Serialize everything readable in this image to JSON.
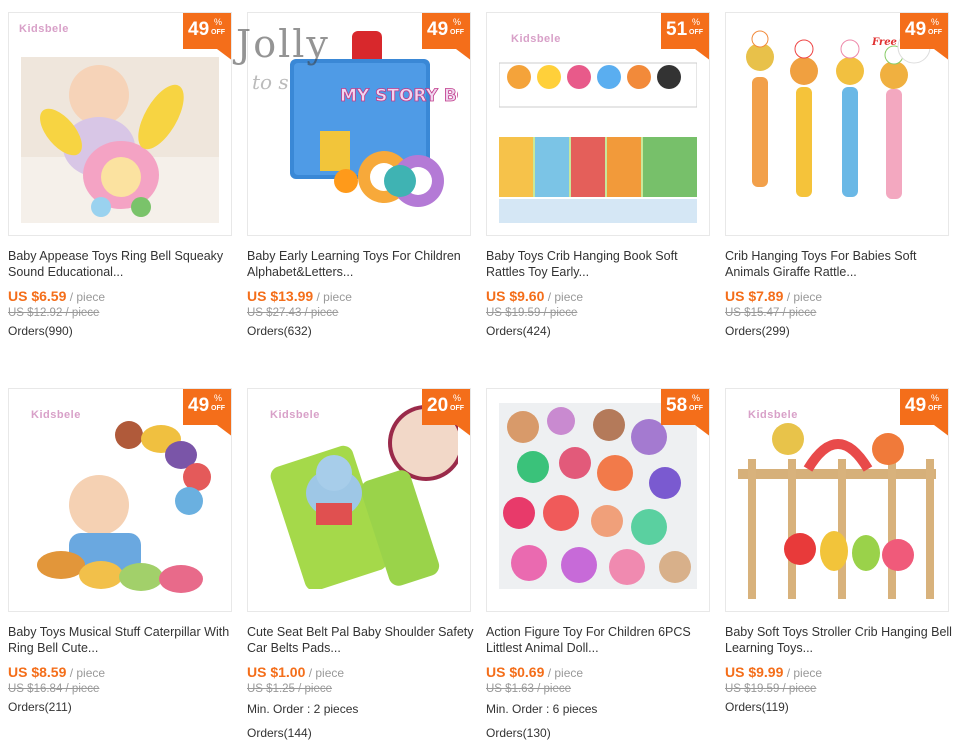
{
  "watermark": {
    "main": "Jolly",
    "sub": "to s"
  },
  "colors": {
    "accent": "#f46e1a",
    "badge": "#f46e1a",
    "muted": "#999999",
    "text": "#333333",
    "brand": "#d8a0c8"
  },
  "products": [
    {
      "brand": "Kidsbele",
      "discount": "49",
      "pct": "%",
      "off": "OFF",
      "title": "Baby Appease Toys Ring Bell Squeaky Sound Educational...",
      "price": "US $6.59",
      "unit": "/ piece",
      "old_price": "US $12.92 / piece",
      "min_order": "",
      "orders": "Orders(990)"
    },
    {
      "brand": "",
      "discount": "49",
      "pct": "%",
      "off": "OFF",
      "title": "Baby Early Learning Toys For Children Alphabet&Letters...",
      "price": "US $13.99",
      "unit": "/ piece",
      "old_price": "US $27.43 / piece",
      "min_order": "",
      "orders": "Orders(632)",
      "book_text": "MY STORY BOOK"
    },
    {
      "brand": "Kidsbele",
      "discount": "51",
      "pct": "%",
      "off": "OFF",
      "title": "Baby Toys Crib Hanging Book Soft Rattles Toy Early...",
      "price": "US $9.60",
      "unit": "/ piece",
      "old_price": "US $19.59 / piece",
      "min_order": "",
      "orders": "Orders(424)"
    },
    {
      "brand": "",
      "discount": "49",
      "pct": "%",
      "off": "OFF",
      "title": "Crib Hanging Toys For Babies Soft Animals Giraffe Rattle...",
      "price": "US $7.89",
      "unit": "/ piece",
      "old_price": "US $15.47 / piece",
      "min_order": "",
      "orders": "Orders(299)",
      "corner_text": "Free G"
    },
    {
      "brand": "Kidsbele",
      "discount": "49",
      "pct": "%",
      "off": "OFF",
      "title": "Baby Toys Musical Stuff Caterpillar With Ring Bell Cute...",
      "price": "US $8.59",
      "unit": "/ piece",
      "old_price": "US $16.84 / piece",
      "min_order": "",
      "orders": "Orders(211)"
    },
    {
      "brand": "Kidsbele",
      "discount": "20",
      "pct": "%",
      "off": "OFF",
      "title": "Cute Seat Belt Pal Baby Shoulder Safety Car Belts Pads...",
      "price": "US $1.00",
      "unit": "/ piece",
      "old_price": "US $1.25 / piece",
      "min_order": "Min. Order : 2 pieces",
      "orders": "Orders(144)"
    },
    {
      "brand": "",
      "discount": "58",
      "pct": "%",
      "off": "OFF",
      "title": "Action Figure Toy For Children 6PCS Littlest Animal Doll...",
      "price": "US $0.69",
      "unit": "/ piece",
      "old_price": "US $1.63 / piece",
      "min_order": "Min. Order : 6 pieces",
      "orders": "Orders(130)"
    },
    {
      "brand": "Kidsbele",
      "discount": "49",
      "pct": "%",
      "off": "OFF",
      "title": "Baby Soft Toys Stroller Crib Hanging Bell Learning Toys...",
      "price": "US $9.99",
      "unit": "/ piece",
      "old_price": "US $19.59 / piece",
      "min_order": "",
      "orders": "Orders(119)"
    }
  ]
}
